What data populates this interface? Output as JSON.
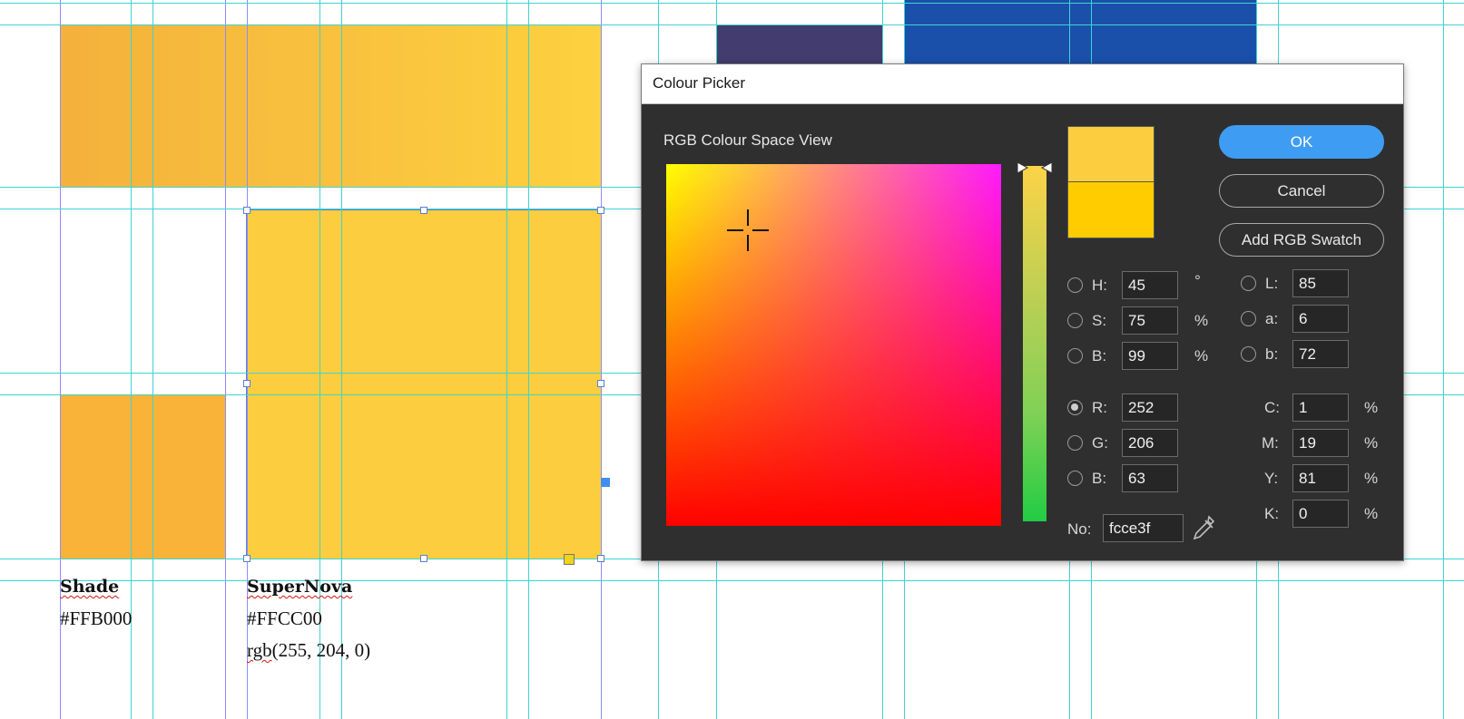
{
  "swatches": [
    {
      "name": "Shade",
      "hex": "#FFB000",
      "rgb": ""
    },
    {
      "name": "SuperNova",
      "hex": "#FFCC00",
      "rgb_prefix": "rgb",
      "rgb_rest": "(255, 204, 0)"
    }
  ],
  "colors": {
    "top_banner_left": "#f4b13c",
    "top_banner_right": "#fdd13f",
    "shade": "#fab339",
    "supernova": "#fcce3f",
    "navy": "#433c6e",
    "blue": "#1a4faa",
    "guide": "#3fd3d3"
  },
  "dialog": {
    "title": "Colour Picker",
    "view_label": "RGB Colour Space View",
    "buttons": {
      "ok": "OK",
      "cancel": "Cancel",
      "add_swatch": "Add RGB Swatch"
    },
    "hsb": [
      {
        "label": "H:",
        "value": "45",
        "unit": "°"
      },
      {
        "label": "S:",
        "value": "75",
        "unit": "%"
      },
      {
        "label": "B:",
        "value": "99",
        "unit": "%"
      }
    ],
    "lab": [
      {
        "label": "L:",
        "value": "85"
      },
      {
        "label": "a:",
        "value": "6"
      },
      {
        "label": "b:",
        "value": "72"
      }
    ],
    "rgb": [
      {
        "label": "R:",
        "value": "252"
      },
      {
        "label": "G:",
        "value": "206"
      },
      {
        "label": "B:",
        "value": "63"
      }
    ],
    "cmyk": [
      {
        "label": "C:",
        "value": "1",
        "unit": "%"
      },
      {
        "label": "M:",
        "value": "19",
        "unit": "%"
      },
      {
        "label": "Y:",
        "value": "81",
        "unit": "%"
      },
      {
        "label": "K:",
        "value": "0",
        "unit": "%"
      }
    ],
    "hex": {
      "label": "No:",
      "value": "fcce3f"
    },
    "new_color": "#fcce3f",
    "old_color": "#ffcc00",
    "selected_mode": "R"
  }
}
